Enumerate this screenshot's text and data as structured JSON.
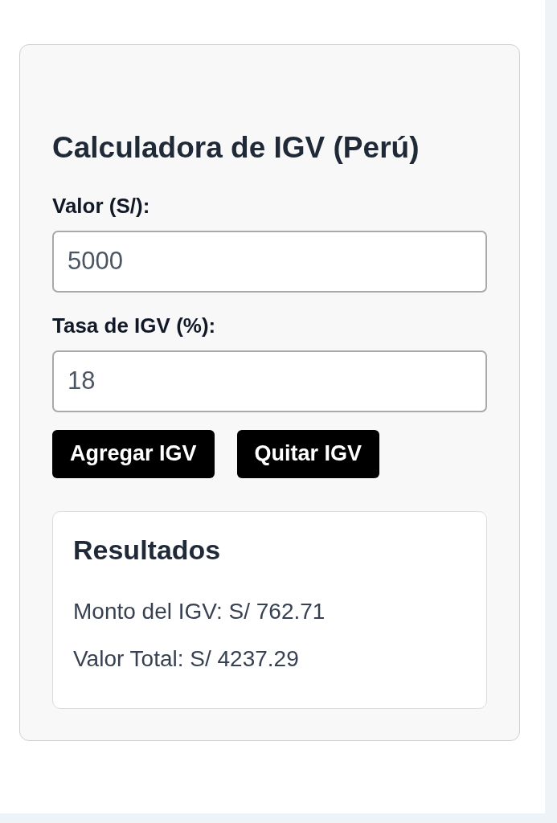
{
  "calculator": {
    "title": "Calculadora de IGV (Perú)",
    "fields": [
      {
        "label": "Valor (S/):",
        "value": "5000"
      },
      {
        "label": "Tasa de IGV (%):",
        "value": "18"
      }
    ],
    "buttons": [
      "Agregar IGV",
      "Quitar IGV"
    ],
    "results": {
      "title": "Resultados",
      "lines": [
        "Monto del IGV: S/ 762.71",
        "Valor Total: S/ 4237.29"
      ]
    }
  }
}
